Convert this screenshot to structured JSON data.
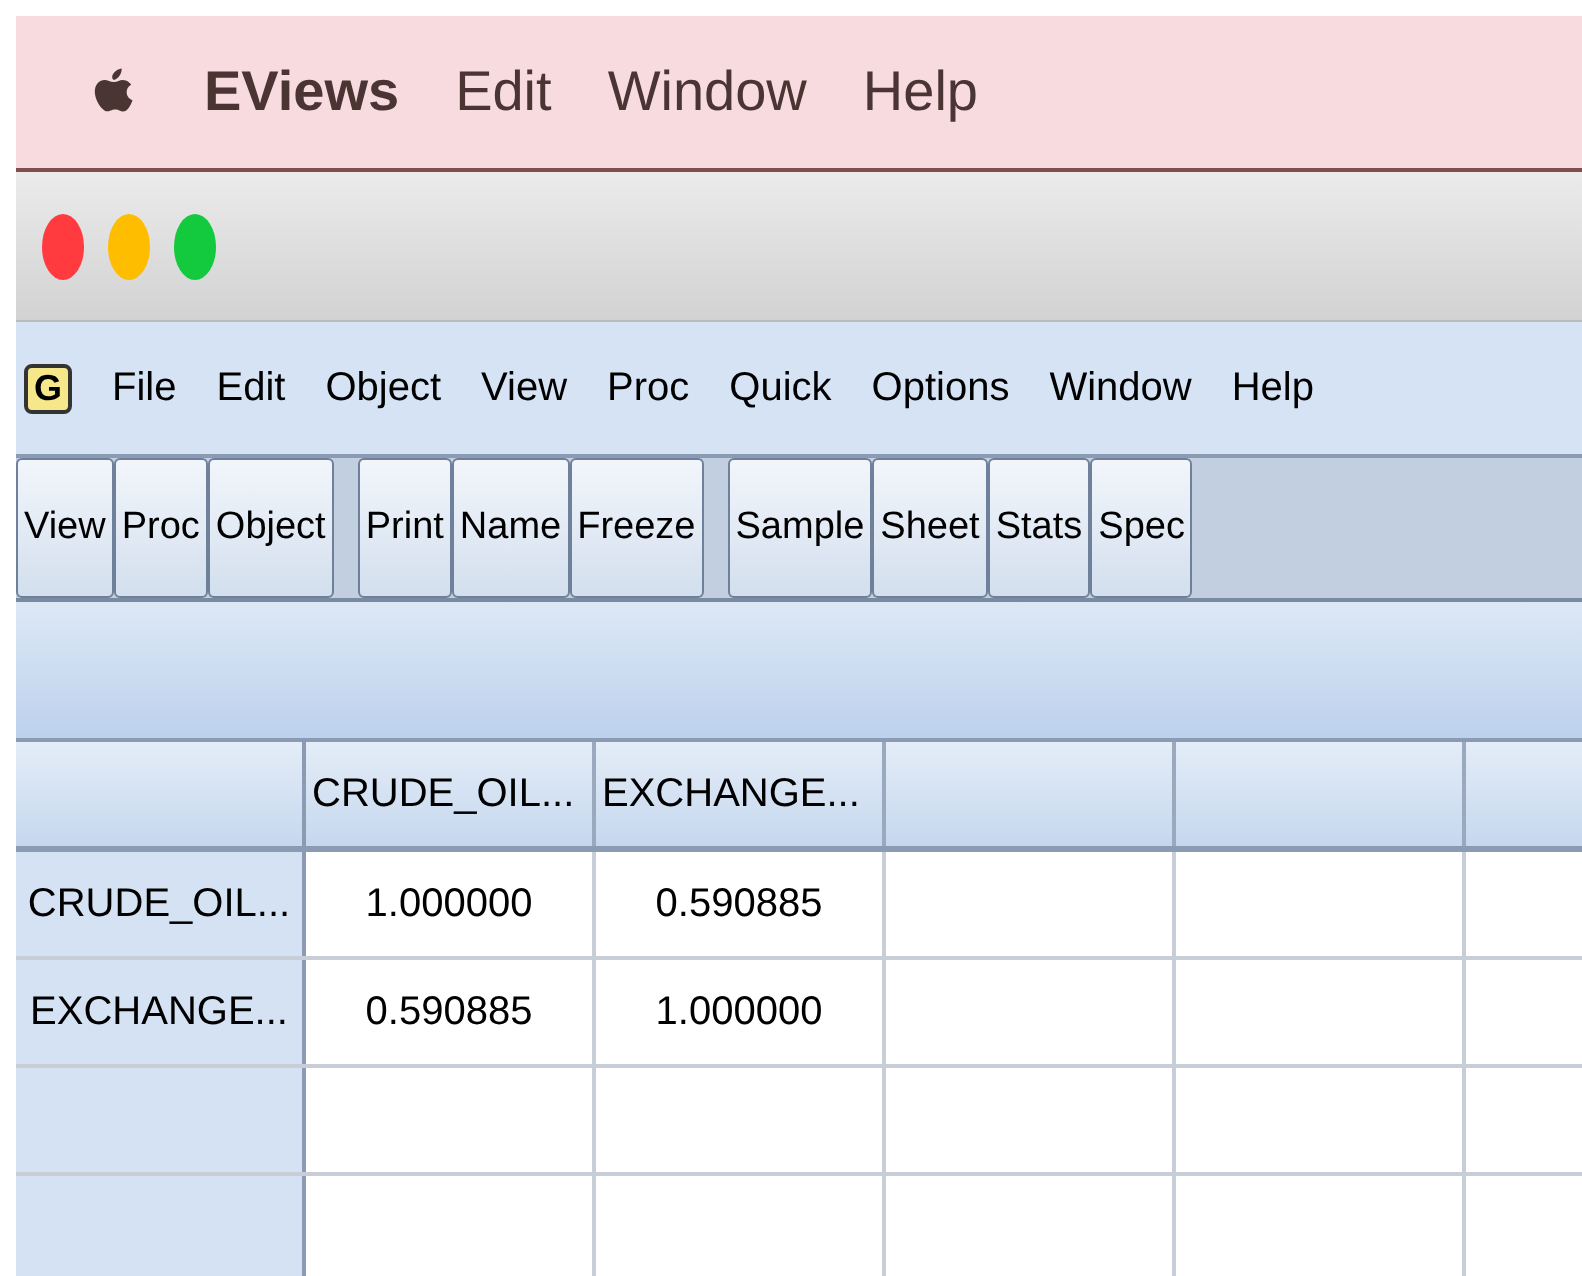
{
  "system_menu": {
    "app_name": "EViews",
    "items": [
      "Edit",
      "Window",
      "Help"
    ]
  },
  "window": {
    "buttons": [
      {
        "color": "#ff3b40"
      },
      {
        "color": "#ffbd00"
      },
      {
        "color": "#13c93d"
      }
    ]
  },
  "menu": {
    "app_badge": "G",
    "items": [
      "File",
      "Edit",
      "Object",
      "View",
      "Proc",
      "Quick",
      "Options",
      "Window",
      "Help"
    ]
  },
  "toolbar": {
    "groups": [
      [
        "View",
        "Proc",
        "Object"
      ],
      [
        "Print",
        "Name",
        "Freeze"
      ],
      [
        "Sample",
        "Sheet",
        "Stats",
        "Spec"
      ]
    ]
  },
  "table": {
    "columns": [
      "CRUDE_OIL...",
      "EXCHANGE..."
    ],
    "rows": [
      {
        "label": "CRUDE_OIL...",
        "cells": [
          "1.000000",
          "0.590885"
        ]
      },
      {
        "label": "EXCHANGE...",
        "cells": [
          "0.590885",
          "1.000000"
        ]
      }
    ]
  }
}
